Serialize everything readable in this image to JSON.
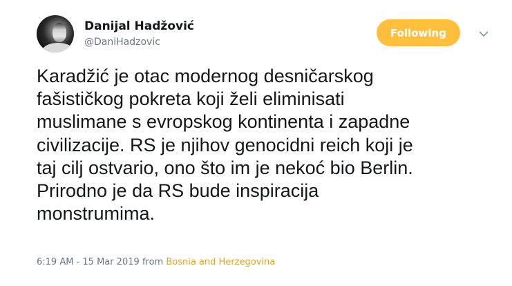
{
  "tweet": {
    "author_name": "Danijal Hadžović",
    "author_handle": "@DaniHadzovic",
    "follow_label": "Following",
    "text_lines": [
      "Karadžić je otac modernog desničarskog",
      "fašističkog pokreta koji želi eliminisati",
      "muslimane s evropskog kontinenta i zapadne",
      "civilizacije. RS je njihov genocidni reich koji je",
      "taj cilj ostvario, ono što im je nekoć bio Berlin.",
      "Prirodno je da RS bude inspiracija",
      "monstrumima."
    ],
    "timestamp": "6:19 AM - 15 Mar 2019",
    "from_label": "from",
    "location": "Bosnia and Herzegovina"
  },
  "icons": {
    "more": "chevron-down-icon"
  },
  "colors": {
    "follow_button": "#ffbf3d",
    "location_link": "#e0a32a",
    "secondary_text": "#657786",
    "primary_text": "#14171a"
  }
}
